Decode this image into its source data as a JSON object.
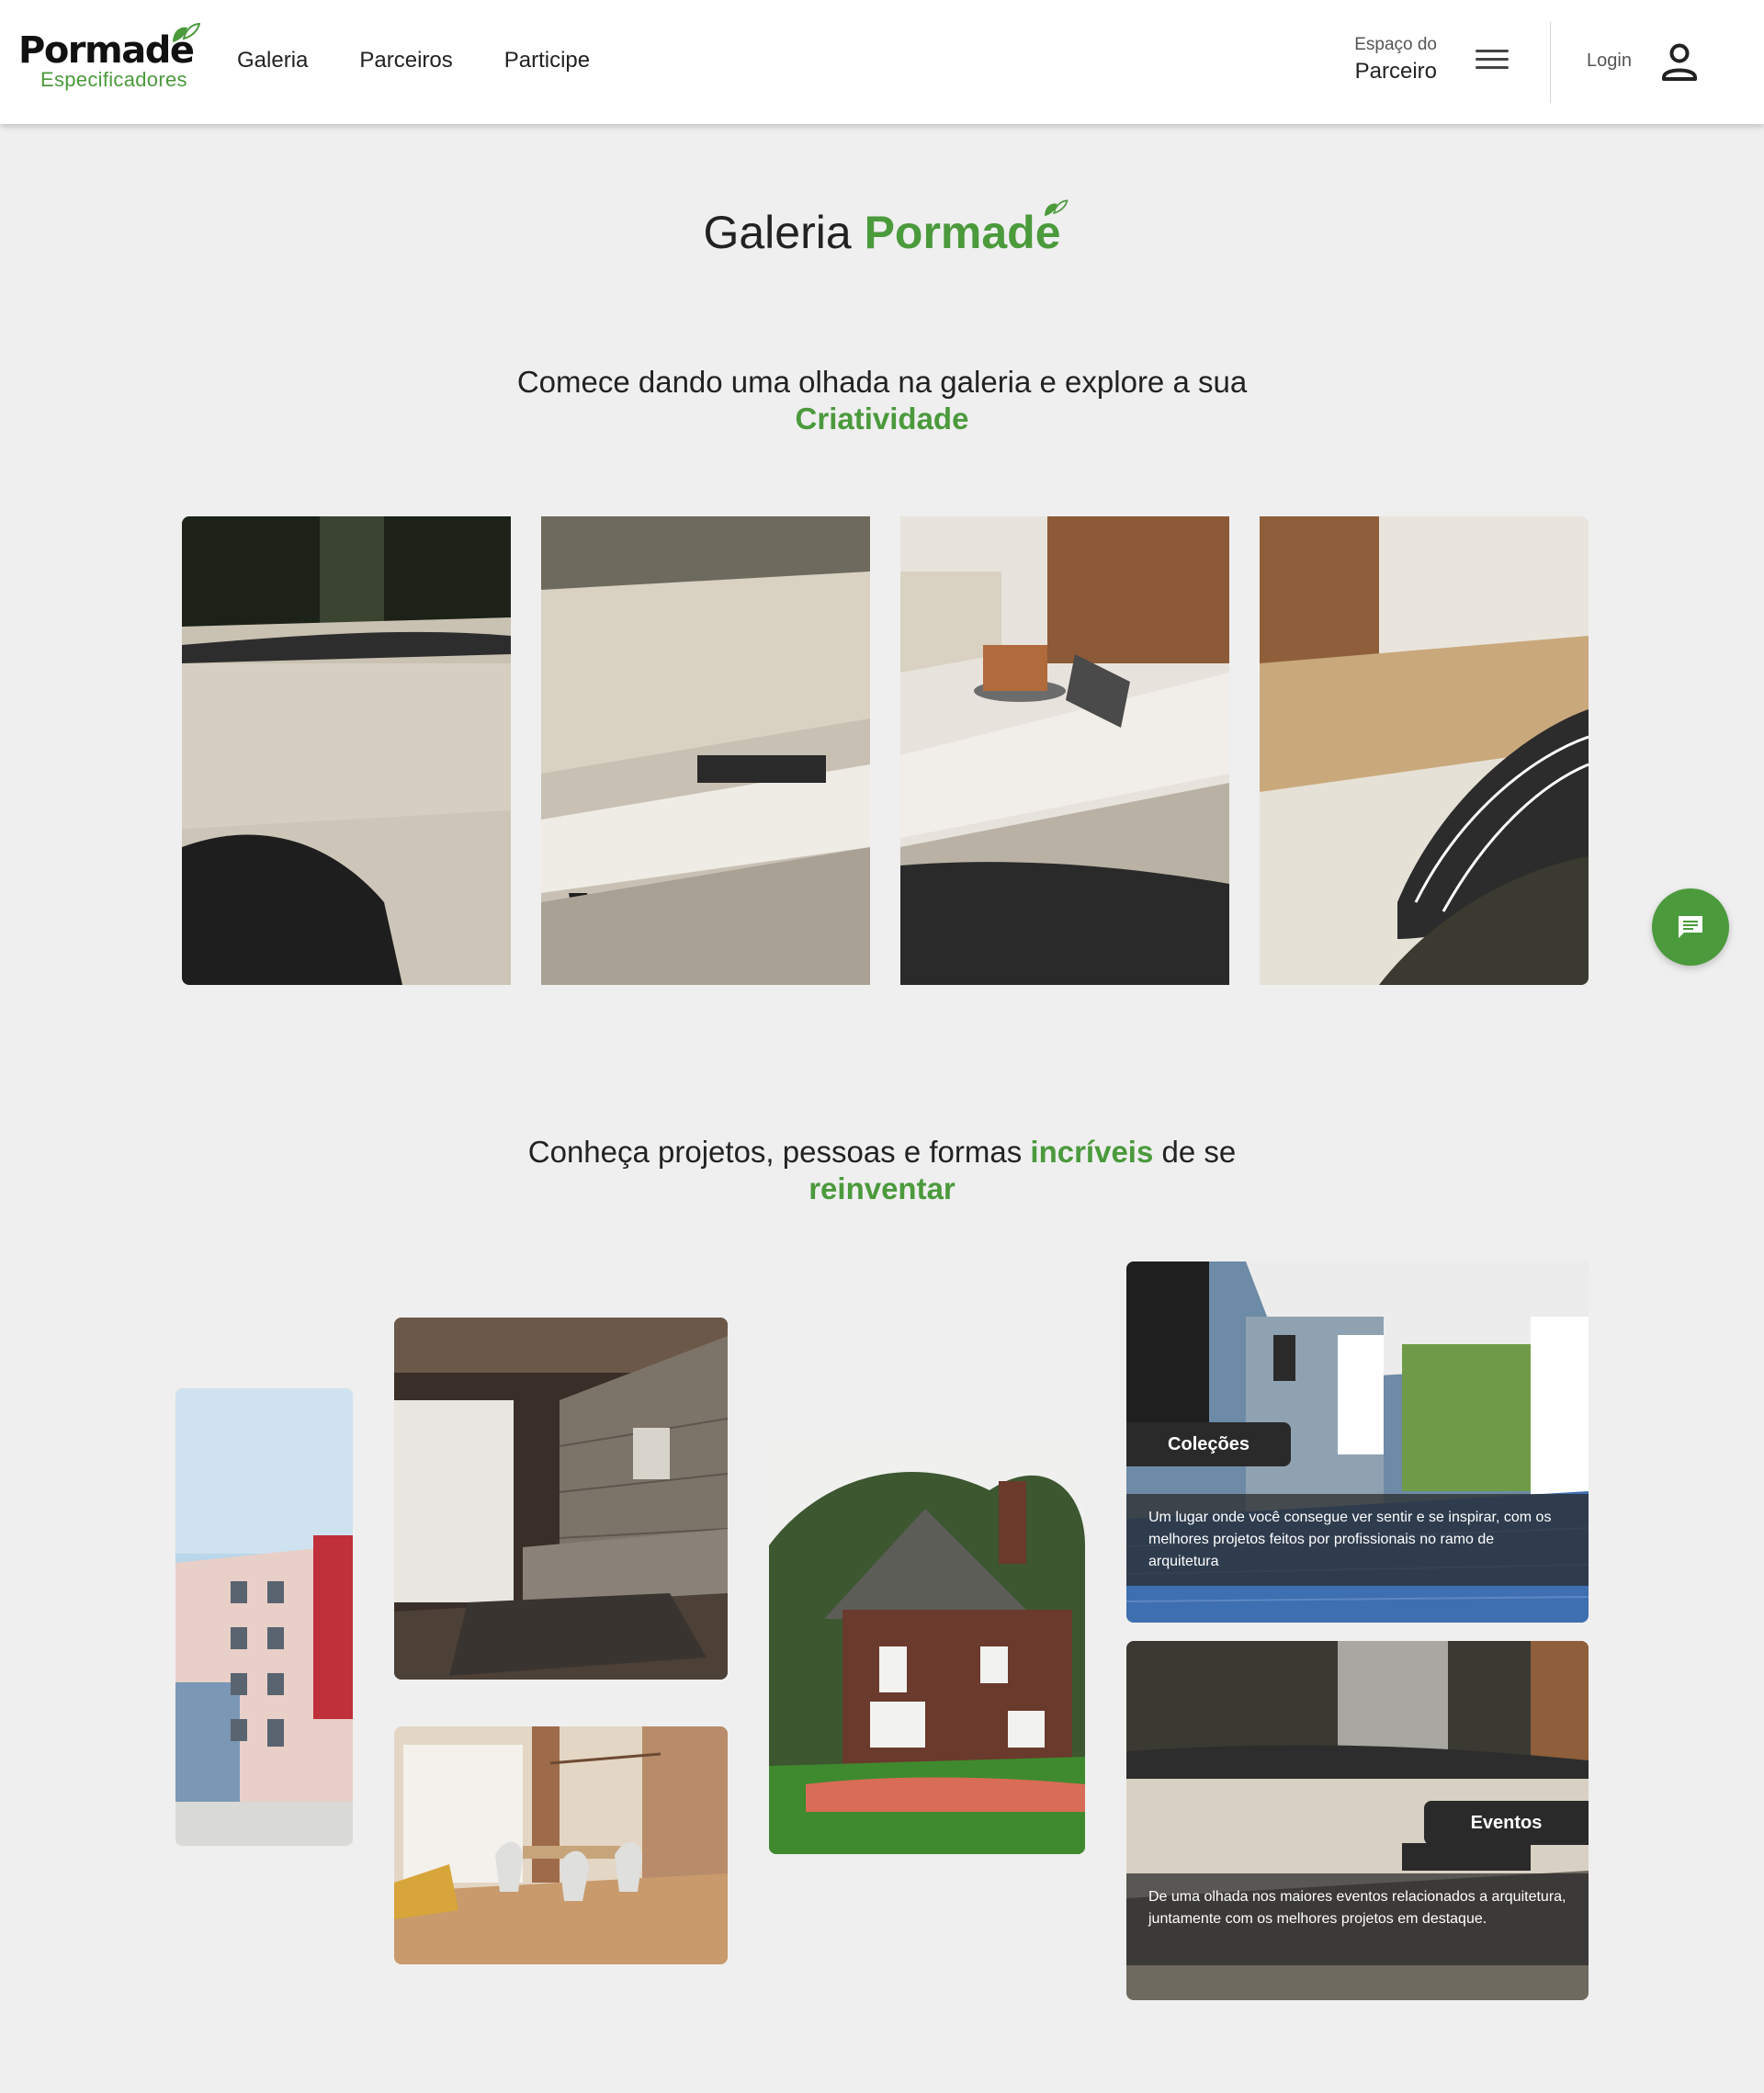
{
  "header": {
    "logo_main": "Pormade",
    "logo_sub": "Especificadores",
    "nav": [
      "Galeria",
      "Parceiros",
      "Participe"
    ],
    "partner_line1": "Espaço do",
    "partner_line2": "Parceiro",
    "login_label": "Login"
  },
  "title": {
    "prefix": "Galeria",
    "brand": "Pormade"
  },
  "section1": {
    "text": "Comece dando uma olhada na galeria e explore a sua",
    "highlight": "Criatividade"
  },
  "section2": {
    "part1": "Conheça projetos, pessoas e formas",
    "highlight1": "incríveis",
    "part2": "de se",
    "highlight2": "reinventar"
  },
  "cards": {
    "colecoes": {
      "tag": "Coleções",
      "description": "Um lugar onde você consegue ver sentir e se inspirar, com os melhores projetos feitos por profissionais no ramo de arquitetura"
    },
    "eventos": {
      "tag": "Eventos",
      "description": "De uma olhada nos maiores eventos relacionados a arquitetura, juntamente com os melhores projetos em destaque."
    }
  },
  "colors": {
    "brand_green": "#4b9a3c",
    "background": "#efefef",
    "text_dark": "#222222",
    "tag_bg": "#2a2a2a"
  },
  "icons": {
    "menu": "hamburger-icon",
    "user": "user-icon",
    "chat": "chat-icon",
    "leaf": "leaf-icon"
  }
}
